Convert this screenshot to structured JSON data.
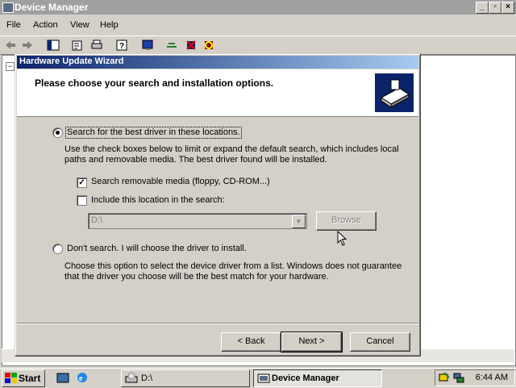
{
  "device_manager": {
    "title": "Device Manager",
    "menu": [
      "File",
      "Action",
      "View",
      "Help"
    ],
    "toolbar_icons": [
      "back-icon",
      "forward-icon",
      "console-tree-icon",
      "properties-icon",
      "print-icon",
      "help-icon",
      "scan-icon",
      "update-driver-icon",
      "uninstall-icon",
      "disable-icon"
    ],
    "tree_expander": "−"
  },
  "wizard": {
    "title": "Hardware Update Wizard",
    "header": "Please choose your search and installation options.",
    "option_search": {
      "label": "Search for the best driver in these locations.",
      "selected": true,
      "description": "Use the check boxes below to limit or expand the default search, which includes local paths and removable media. The best driver found will be installed."
    },
    "check_removable": {
      "label": "Search removable media (floppy, CD-ROM...)",
      "checked": true
    },
    "check_location": {
      "label": "Include this location in the search:",
      "checked": false
    },
    "location_value": "D:\\",
    "browse_label": "Browse",
    "option_dont_search": {
      "label": "Don't search. I will choose the driver to install.",
      "selected": false,
      "description": "Choose this option to select the device driver from a list.  Windows does not guarantee that the driver you choose will be the best match for your hardware."
    },
    "buttons": {
      "back": "< Back",
      "next": "Next >",
      "cancel": "Cancel"
    }
  },
  "taskbar": {
    "start_label": "Start",
    "tasks": [
      {
        "label": "D:\\",
        "active": false
      },
      {
        "label": "Device Manager",
        "active": true
      }
    ],
    "clock": "6:44 AM"
  },
  "colors": {
    "title_active": "#0a246a",
    "title_inactive": "#a0a0a0",
    "face": "#d4d0c8"
  }
}
